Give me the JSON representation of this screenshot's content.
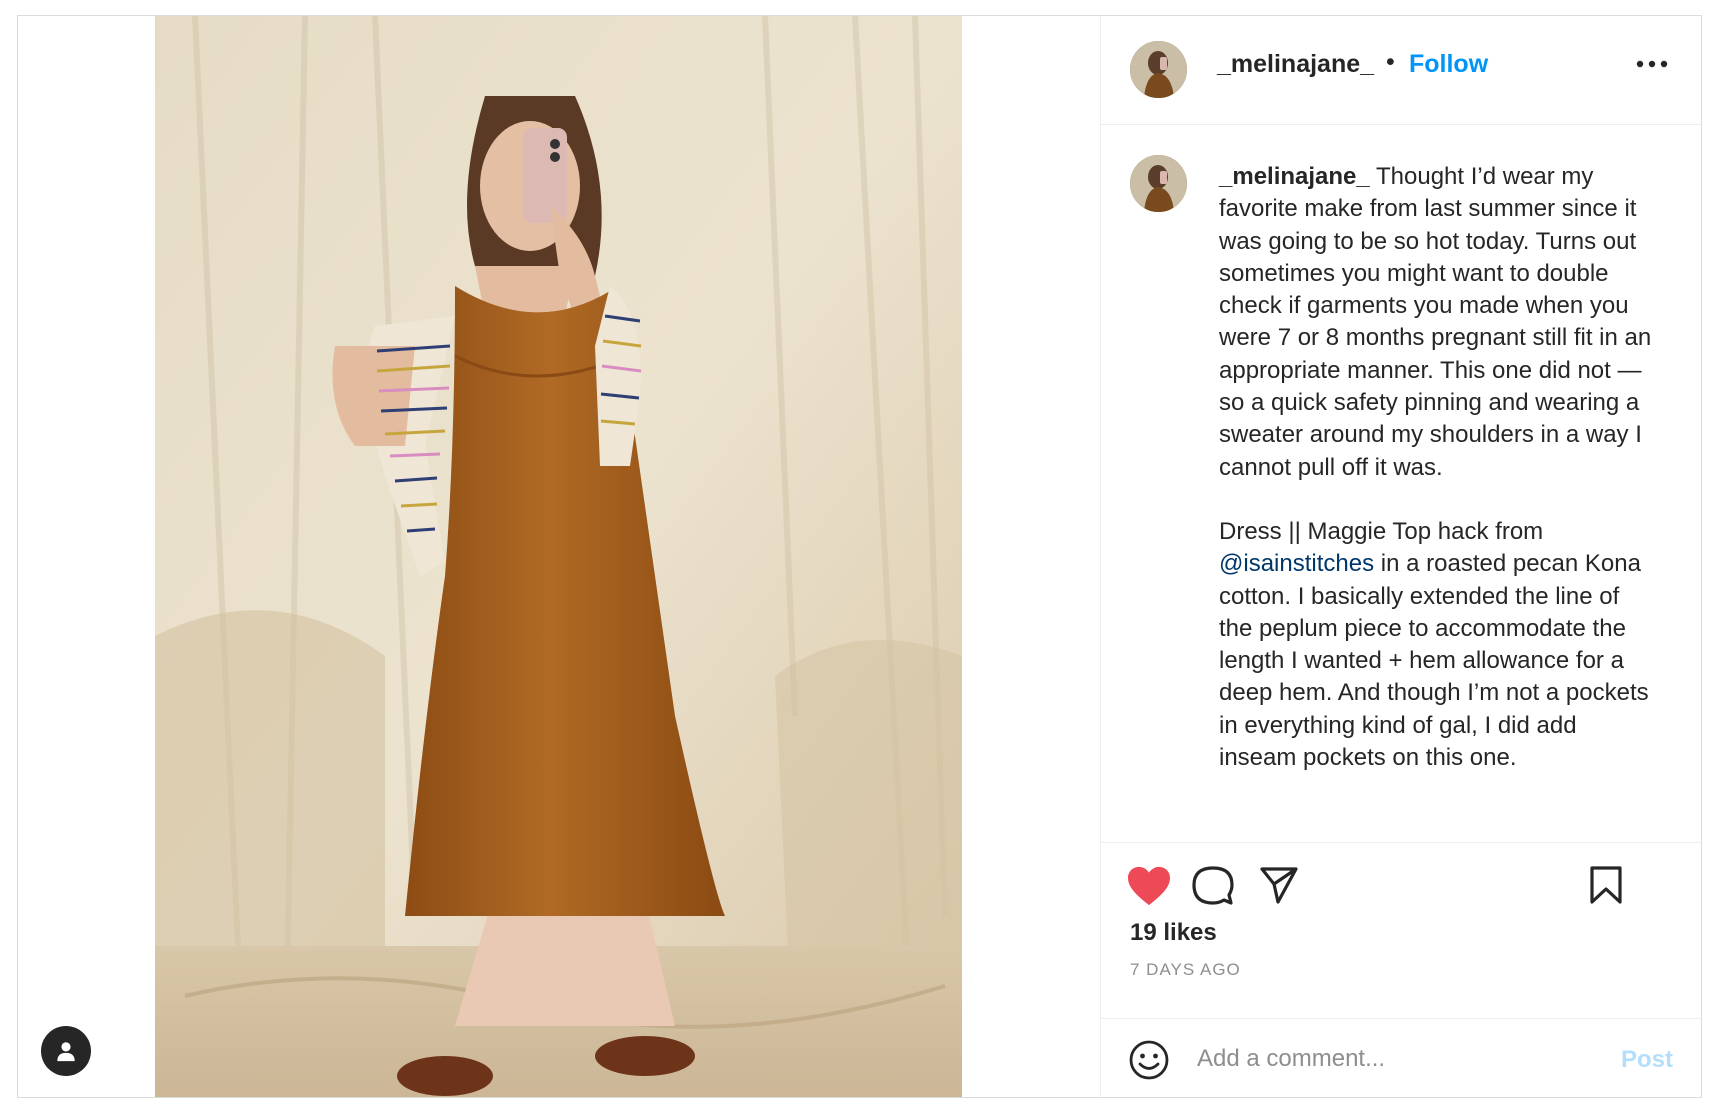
{
  "post": {
    "username": "_melinajane_",
    "separator": "•",
    "follow_label": "Follow",
    "more_icon": "more-options-icon",
    "caption": {
      "username": "_melinajane_",
      "paragraph1": " Thought I’d wear my favorite make from last summer since it was going to be so hot today. Turns out sometimes you might want to double check if garments you made when you were 7 or 8 months pregnant still fit in an appropriate manner. This one did not — so a quick safety pinning and wearing a sweater around my shoulders in a way I cannot pull off it was.",
      "paragraph2_before": "Dress || Maggie Top hack from ",
      "mention": "@isainstitches",
      "paragraph2_after": " in a roasted pecan Kona cotton. I basically extended the line of the peplum piece to accommodate the length I wanted + hem allowance for a deep hem. And though I’m not a pockets in everything kind of gal, I did add inseam pockets on this one."
    },
    "likes": "19 likes",
    "time": "7 DAYS AGO",
    "comment": {
      "placeholder": "Add a comment...",
      "post_label": "Post"
    }
  },
  "colors": {
    "link_blue": "#0095f6",
    "mention_blue": "#00376b",
    "like_red": "#ed4956",
    "post_disabled": "#b2dffc",
    "muted": "#8e8e8e"
  }
}
